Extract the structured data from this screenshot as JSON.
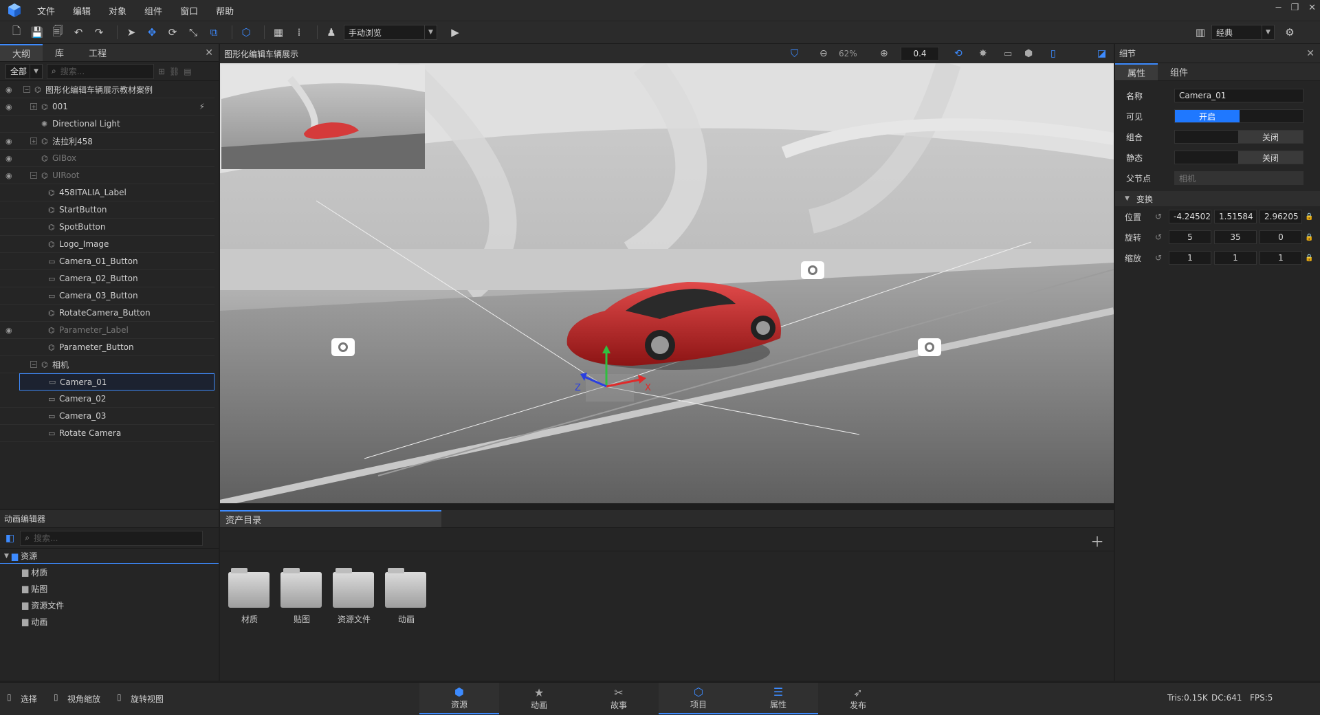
{
  "menubar": {
    "items": [
      "文件",
      "编辑",
      "对象",
      "组件",
      "窗口",
      "帮助"
    ]
  },
  "toolbar": {
    "mode_select": "手动浏览",
    "layout_select": "经典"
  },
  "outline": {
    "tabs": [
      "大纲",
      "库",
      "工程"
    ],
    "filter": "全部",
    "search_placeholder": "搜索...",
    "tree": [
      {
        "label": "图形化编辑车辆展示教材案例",
        "level": 0,
        "eye": true,
        "expand": "⊟",
        "dim": false
      },
      {
        "label": "001",
        "level": 1,
        "eye": true,
        "expand": "⊞",
        "dim": false
      },
      {
        "label": "Directional Light",
        "level": 1,
        "eye": false,
        "expand": "",
        "dim": false
      },
      {
        "label": "法拉利458",
        "level": 1,
        "eye": true,
        "expand": "⊞",
        "dim": false
      },
      {
        "label": "GIBox",
        "level": 1,
        "eye": true,
        "expand": "",
        "dim": true
      },
      {
        "label": "UIRoot",
        "level": 1,
        "eye": true,
        "expand": "⊟",
        "dim": true
      },
      {
        "label": "458ITALIA_Label",
        "level": 2,
        "eye": false,
        "expand": "",
        "dim": false
      },
      {
        "label": "StartButton",
        "level": 2,
        "eye": false,
        "expand": "",
        "dim": false
      },
      {
        "label": "SpotButton",
        "level": 2,
        "eye": false,
        "expand": "",
        "dim": false
      },
      {
        "label": "Logo_Image",
        "level": 2,
        "eye": false,
        "expand": "",
        "dim": false
      },
      {
        "label": "Camera_01_Button",
        "level": 2,
        "eye": false,
        "expand": "",
        "dim": false
      },
      {
        "label": "Camera_02_Button",
        "level": 2,
        "eye": false,
        "expand": "",
        "dim": false
      },
      {
        "label": "Camera_03_Button",
        "level": 2,
        "eye": false,
        "expand": "",
        "dim": false
      },
      {
        "label": "RotateCamera_Button",
        "level": 2,
        "eye": false,
        "expand": "",
        "dim": false
      },
      {
        "label": "Parameter_Label",
        "level": 2,
        "eye": true,
        "expand": "",
        "dim": true
      },
      {
        "label": "Parameter_Button",
        "level": 2,
        "eye": false,
        "expand": "",
        "dim": false
      },
      {
        "label": "相机",
        "level": 1,
        "eye": false,
        "expand": "⊟",
        "dim": false
      },
      {
        "label": "Camera_01",
        "level": 2,
        "eye": false,
        "expand": "",
        "dim": false,
        "selected": true
      },
      {
        "label": "Camera_02",
        "level": 2,
        "eye": false,
        "expand": "",
        "dim": false
      },
      {
        "label": "Camera_03",
        "level": 2,
        "eye": false,
        "expand": "",
        "dim": false
      },
      {
        "label": "Rotate Camera",
        "level": 2,
        "eye": false,
        "expand": "",
        "dim": false
      }
    ]
  },
  "viewport": {
    "title": "图形化编辑车辆展示",
    "zoom": "62%",
    "speed": "0.4",
    "axis_x": "X",
    "axis_z": "Z"
  },
  "details": {
    "title": "细节",
    "tabs": [
      "属性",
      "组件"
    ],
    "name_label": "名称",
    "name_value": "Camera_01",
    "visible_label": "可见",
    "visible_value": "开启",
    "group_label": "组合",
    "group_value": "关闭",
    "static_label": "静态",
    "static_value": "关闭",
    "parent_label": "父节点",
    "parent_value": "相机",
    "transform_label": "变换",
    "position_label": "位置",
    "position": [
      "-4.24502",
      "1.51584",
      "2.96205"
    ],
    "rotation_label": "旋转",
    "rotation": [
      "5",
      "35",
      "0"
    ],
    "scale_label": "缩放",
    "scale": [
      "1",
      "1",
      "1"
    ]
  },
  "anim_editor": {
    "title": "动画编辑器",
    "search_placeholder": "搜索...",
    "root": "资源",
    "children": [
      "材质",
      "贴图",
      "资源文件",
      "动画"
    ]
  },
  "assets": {
    "tab": "资产目录",
    "folders": [
      "材质",
      "贴图",
      "资源文件",
      "动画"
    ]
  },
  "statusbar": {
    "hints": [
      "选择",
      "视角缩放",
      "旋转视图"
    ],
    "tabs": [
      "资源",
      "动画",
      "故事",
      "项目",
      "属性",
      "发布"
    ],
    "stats": [
      "Tris:0.15K",
      "DC:641",
      "FPS:5"
    ]
  }
}
